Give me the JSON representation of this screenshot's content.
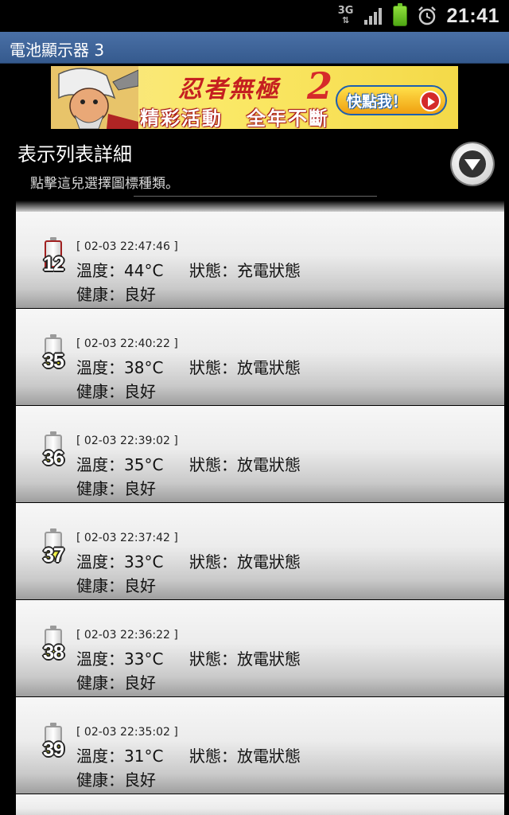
{
  "status_bar": {
    "network": "3G",
    "network_arrows": "⇅",
    "time": "21:41",
    "icons": [
      "network-3g-icon",
      "signal-icon",
      "battery-icon",
      "alarm-icon"
    ]
  },
  "app": {
    "title": "電池顯示器 3"
  },
  "ad": {
    "logo": "忍者無極",
    "logo_number": "2",
    "tagline_left": "精彩活動",
    "tagline_right": "全年不斷",
    "cta": "快點我！"
  },
  "header": {
    "title": "表示列表詳細",
    "subtitle": "點擊這兒選擇圖標種類。",
    "selector_icon": "chevron-down-circle-icon"
  },
  "rows": [
    {
      "level": "12",
      "charging": true,
      "fill_pct": 12,
      "time": "[ 02-03 22:47:46 ]",
      "temp": "溫度：44°C",
      "state": "狀態：充電狀態",
      "health": "健康：良好"
    },
    {
      "level": "35",
      "charging": false,
      "fill_pct": 35,
      "time": "[ 02-03 22:40:22 ]",
      "temp": "溫度：38°C",
      "state": "狀態：放電狀態",
      "health": "健康：良好"
    },
    {
      "level": "36",
      "charging": false,
      "fill_pct": 36,
      "time": "[ 02-03 22:39:02 ]",
      "temp": "溫度：35°C",
      "state": "狀態：放電狀態",
      "health": "健康：良好"
    },
    {
      "level": "37",
      "charging": false,
      "fill_pct": 37,
      "time": "[ 02-03 22:37:42 ]",
      "temp": "溫度：33°C",
      "state": "狀態：放電狀態",
      "health": "健康：良好"
    },
    {
      "level": "38",
      "charging": false,
      "fill_pct": 38,
      "time": "[ 02-03 22:36:22 ]",
      "temp": "溫度：33°C",
      "state": "狀態：放電狀態",
      "health": "健康：良好"
    },
    {
      "level": "39",
      "charging": false,
      "fill_pct": 39,
      "time": "[ 02-03 22:35:02 ]",
      "temp": "溫度：31°C",
      "state": "狀態：放電狀態",
      "health": "健康：良好"
    }
  ],
  "colors": {
    "title_bar": "#3f6699",
    "charging_fill": "#e03030",
    "discharging_fill": "#f2f200"
  }
}
